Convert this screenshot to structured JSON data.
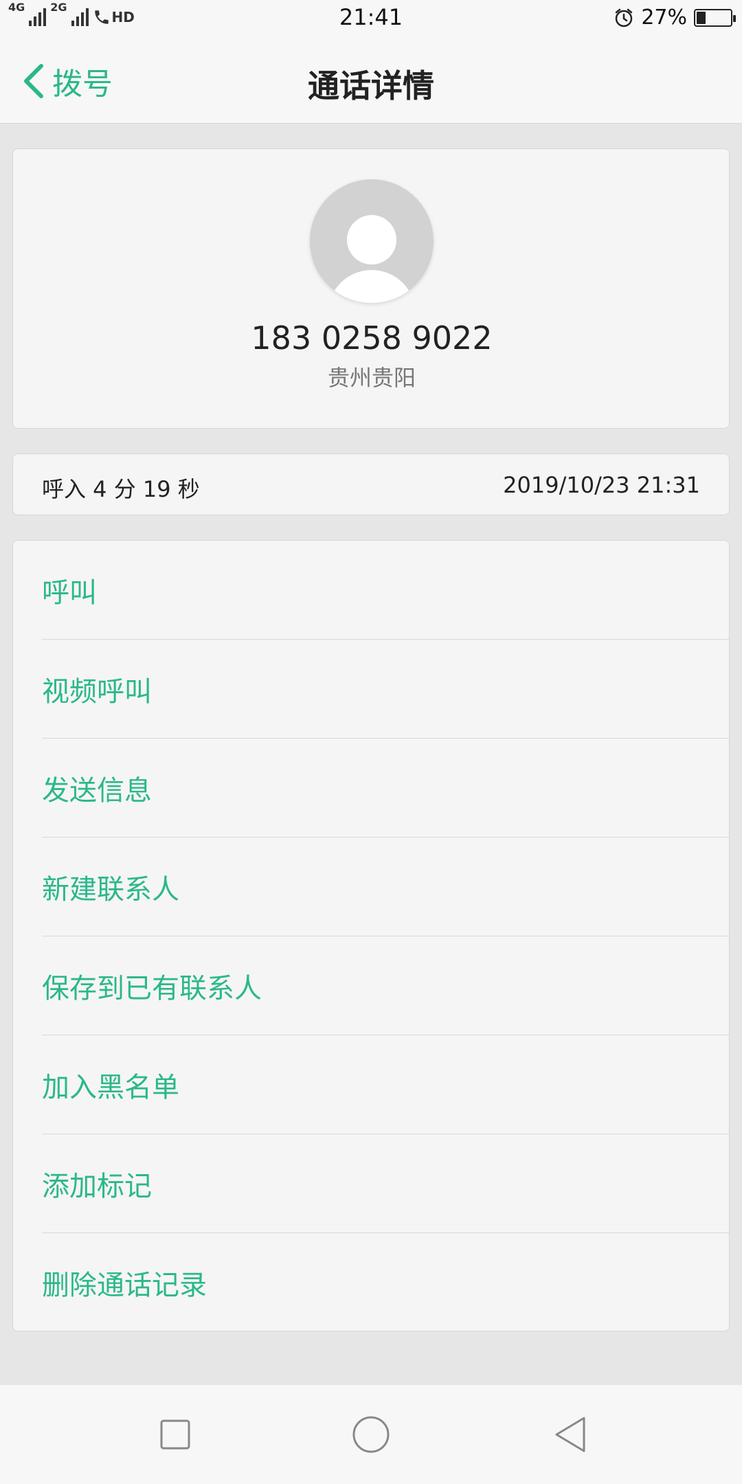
{
  "status_bar": {
    "network_1": "4G",
    "network_2": "2G",
    "hd": "HD",
    "time": "21:41",
    "battery_pct": "27%",
    "battery_level": 0.27,
    "icons": [
      "signal-icon",
      "call-hd-icon",
      "alarm-icon",
      "battery-icon"
    ]
  },
  "header": {
    "back_label": "拨号",
    "title": "通话详情"
  },
  "contact": {
    "phone": "183 0258 9022",
    "location": "贵州贵阳"
  },
  "call_log": {
    "type_duration": "呼入  4 分 19 秒",
    "datetime": "2019/10/23 21:31"
  },
  "actions": [
    {
      "label": "呼叫"
    },
    {
      "label": "视频呼叫"
    },
    {
      "label": "发送信息"
    },
    {
      "label": "新建联系人"
    },
    {
      "label": "保存到已有联系人"
    },
    {
      "label": "加入黑名单"
    },
    {
      "label": "添加标记"
    },
    {
      "label": "删除通话记录"
    }
  ],
  "nav": {
    "icons": [
      "recents-square-icon",
      "home-circle-icon",
      "back-triangle-icon"
    ]
  },
  "colors": {
    "accent": "#2bb88a",
    "background": "#e6e6e6",
    "card": "#f5f5f5"
  }
}
